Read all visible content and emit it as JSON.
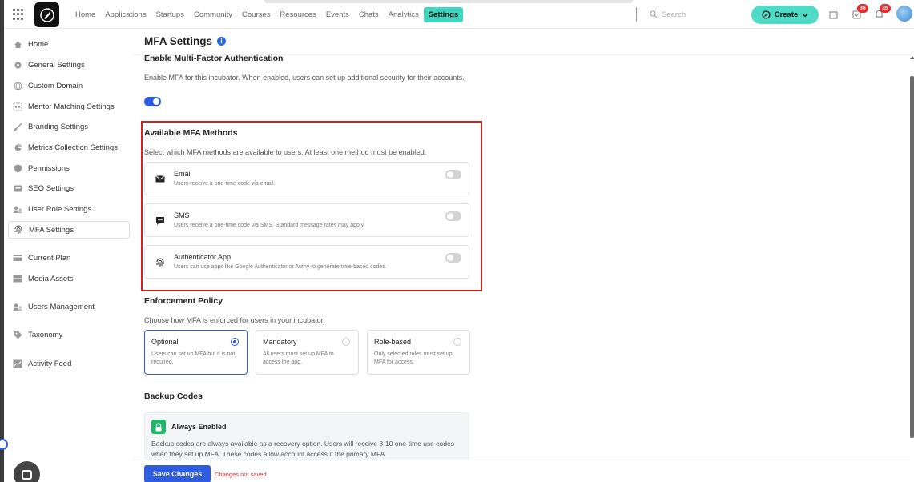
{
  "topbar": {
    "nav": [
      "Home",
      "Applications",
      "Startups",
      "Community",
      "Courses",
      "Resources",
      "Events",
      "Chats",
      "Analytics",
      "Settings"
    ],
    "active_nav": "Settings",
    "search_placeholder": "Search",
    "create_label": "Create",
    "badge_tasks": "36",
    "badge_notifications": "35"
  },
  "sidebar": {
    "items": [
      {
        "label": "Home",
        "icon": "home-icon"
      },
      {
        "label": "General Settings",
        "icon": "gear-icon"
      },
      {
        "label": "Custom Domain",
        "icon": "globe-icon"
      },
      {
        "label": "Mentor Matching Settings",
        "icon": "match-icon"
      },
      {
        "label": "Branding Settings",
        "icon": "brush-icon"
      },
      {
        "label": "Metrics Collection Settings",
        "icon": "pie-chart-icon"
      },
      {
        "label": "Permissions",
        "icon": "shield-icon"
      },
      {
        "label": "SEO Settings",
        "icon": "seo-icon"
      },
      {
        "label": "User Role Settings",
        "icon": "users-icon"
      },
      {
        "label": "MFA Settings",
        "icon": "fingerprint-icon"
      },
      {
        "label": "Current Plan",
        "icon": "card-icon"
      },
      {
        "label": "Media Assets",
        "icon": "media-icon"
      },
      {
        "label": "Users Management",
        "icon": "users-icon"
      },
      {
        "label": "Taxonomy",
        "icon": "tag-icon"
      },
      {
        "label": "Activity Feed",
        "icon": "activity-icon"
      }
    ]
  },
  "main": {
    "title": "MFA Settings",
    "enable": {
      "heading": "Enable Multi-Factor Authentication",
      "description": "Enable MFA for this incubator. When enabled, users can set up additional security for their accounts."
    },
    "methods": {
      "heading": "Available MFA Methods",
      "description": "Select which MFA methods are available to users. At least one method must be enabled.",
      "items": [
        {
          "title": "Email",
          "desc": "Users receive a one-time code via email."
        },
        {
          "title": "SMS",
          "desc": "Users receive a one-time code via SMS. Standard message rates may apply."
        },
        {
          "title": "Authenticator App",
          "desc": "Users can use apps like Google Authenticator or Authy to generate time-based codes."
        }
      ]
    },
    "policy": {
      "heading": "Enforcement Policy",
      "description": "Choose how MFA is enforced for users in your incubator.",
      "options": [
        {
          "title": "Optional",
          "desc": "Users can set up MFA but it is not required."
        },
        {
          "title": "Mandatory",
          "desc": "All users must set up MFA to access the app."
        },
        {
          "title": "Role-based",
          "desc": "Only selected roles must set up MFA for access."
        }
      ]
    },
    "backup": {
      "heading": "Backup Codes",
      "card_title": "Always Enabled",
      "card_desc": "Backup codes are always available as a recovery option. Users will receive 8-10 one-time use codes when they set up MFA. These codes allow account access if the primary MFA"
    },
    "footer": {
      "save_label": "Save Changes",
      "status": "Changes not saved"
    }
  },
  "colors": {
    "accent": "#2f5be0",
    "brand": "#3fd6c0",
    "highlight": "#d42020"
  }
}
